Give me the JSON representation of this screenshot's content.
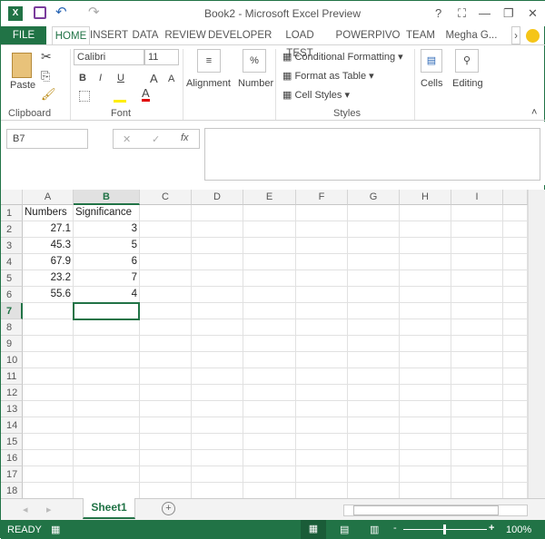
{
  "window": {
    "title": "Book2 - Microsoft Excel Preview",
    "help": "?",
    "minimize": "—",
    "restore": "❐",
    "close": "✕"
  },
  "qat": {
    "undo": "↶",
    "redo": "↷"
  },
  "tabs": [
    "FILE",
    "HOME",
    "INSERT",
    "DATA",
    "REVIEW",
    "DEVELOPER",
    "LOAD TEST",
    "POWERPIVO",
    "TEAM"
  ],
  "user": "Megha G...",
  "ribbon": {
    "paste": "Paste",
    "clipboard": "Clipboard",
    "font_name": "Calibri",
    "font_size": "11",
    "font": "Font",
    "bold": "B",
    "italic": "I",
    "underline": "U",
    "grow": "A",
    "shrink": "A",
    "font_color": "A",
    "alignment": "Alignment",
    "number": "Number",
    "percent": "%",
    "conditional": "Conditional Formatting",
    "format_table": "Format as Table",
    "cell_styles": "Cell Styles",
    "styles": "Styles",
    "cells": "Cells",
    "editing": "Editing"
  },
  "formula": {
    "name_box": "B7",
    "fx": "fx",
    "cancel": "✕",
    "enter": "✓",
    "value": ""
  },
  "columns": [
    "A",
    "B",
    "C",
    "D",
    "E",
    "F",
    "G",
    "H",
    "I"
  ],
  "rows": [
    [
      "Numbers",
      "Significance"
    ],
    [
      "27.1",
      "3"
    ],
    [
      "45.3",
      "5"
    ],
    [
      "67.9",
      "6"
    ],
    [
      "23.2",
      "7"
    ],
    [
      "55.6",
      "4"
    ]
  ],
  "row_count": 18,
  "selected": "B7",
  "sheet": {
    "tab": "Sheet1",
    "add": "+"
  },
  "status": {
    "mode": "READY",
    "zoom": "100%"
  },
  "colors": {
    "accent": "#217346"
  }
}
